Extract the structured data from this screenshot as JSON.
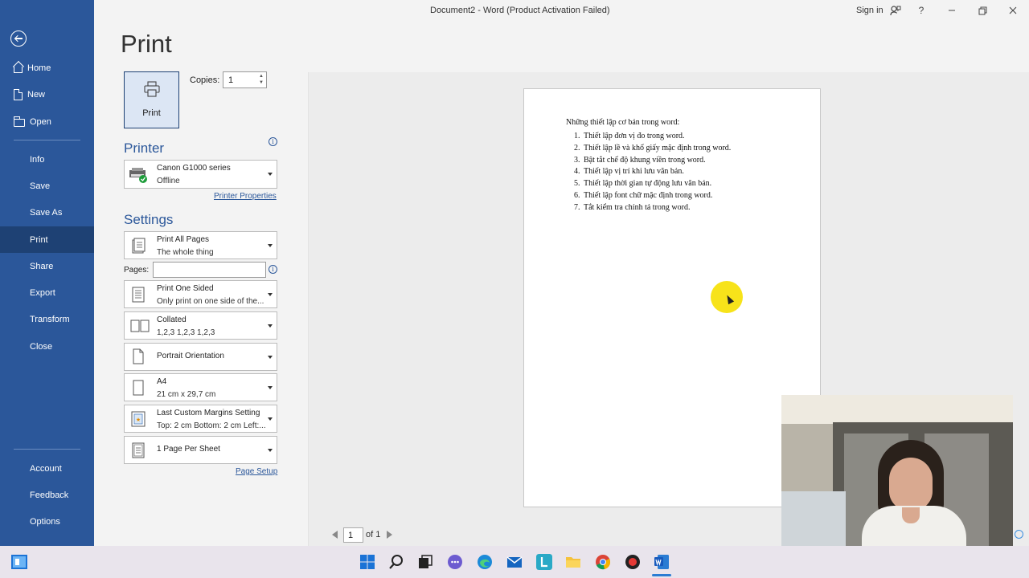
{
  "window": {
    "title": "Document2  -  Word (Product Activation Failed)",
    "sign_in": "Sign in",
    "help": "?"
  },
  "nav": {
    "items": [
      {
        "label": "Home"
      },
      {
        "label": "New"
      },
      {
        "label": "Open"
      },
      {
        "label": "Info"
      },
      {
        "label": "Save"
      },
      {
        "label": "Save As"
      },
      {
        "label": "Print"
      },
      {
        "label": "Share"
      },
      {
        "label": "Export"
      },
      {
        "label": "Transform"
      },
      {
        "label": "Close"
      }
    ],
    "bottom": [
      {
        "label": "Account"
      },
      {
        "label": "Feedback"
      },
      {
        "label": "Options"
      }
    ]
  },
  "print": {
    "title": "Print",
    "button_label": "Print",
    "copies_label": "Copies:",
    "copies_value": "1",
    "printer_heading": "Printer",
    "printer_name": "Canon G1000 series",
    "printer_status": "Offline",
    "printer_properties": "Printer Properties",
    "settings_heading": "Settings",
    "pages_label": "Pages:",
    "pages_value": "",
    "settings": [
      {
        "line1": "Print All Pages",
        "line2": "The whole thing"
      },
      {
        "line1": "Print One Sided",
        "line2": "Only print on one side of the..."
      },
      {
        "line1": "Collated",
        "line2": "1,2,3    1,2,3    1,2,3"
      },
      {
        "line1": "Portrait Orientation",
        "line2": ""
      },
      {
        "line1": "A4",
        "line2": "21 cm x 29,7 cm"
      },
      {
        "line1": "Last Custom Margins Setting",
        "line2": "Top: 2 cm Bottom: 2 cm Left:..."
      },
      {
        "line1": "1 Page Per Sheet",
        "line2": ""
      }
    ],
    "page_setup": "Page Setup"
  },
  "preview": {
    "heading": "Những thiết lập cơ bản trong word:",
    "items": [
      {
        "num": "1.",
        "text": "Thiết lập đơn vị đo trong word."
      },
      {
        "num": "2.",
        "text": "Thiết lập lề và khổ giấy mặc định trong word."
      },
      {
        "num": "3.",
        "text": "Bật tắt chế độ khung viền trong word."
      },
      {
        "num": "4.",
        "text": "Thiết lập vị trí khi lưu văn bản."
      },
      {
        "num": "5.",
        "text": "Thiết lập thời gian tự động lưu văn bản."
      },
      {
        "num": "6.",
        "text": "Thiết lập font chữ mặc định trong word."
      },
      {
        "num": "7.",
        "text": "Tắt kiểm tra chính tả trong word."
      }
    ],
    "current_page": "1",
    "of_pages": "of 1"
  },
  "colors": {
    "nav_bg": "#2b579a",
    "nav_active": "#1e4174",
    "accent": "#2b579a"
  }
}
